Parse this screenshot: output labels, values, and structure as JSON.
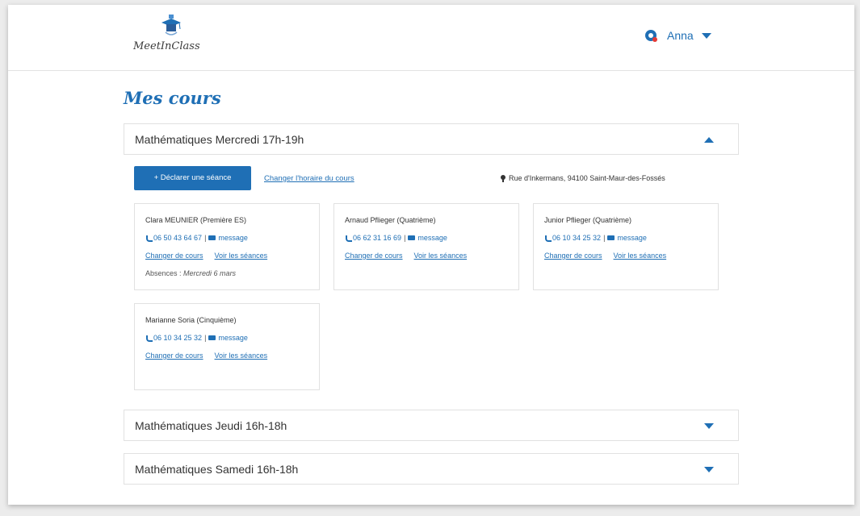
{
  "header": {
    "logo_text": "MeetInClass",
    "user_name": "Anna",
    "notification_icon": "notification-bell-icon"
  },
  "page": {
    "title": "Mes cours"
  },
  "courses": [
    {
      "title": "Mathématiques Mercredi 17h-19h",
      "expanded": true,
      "declare_button": "+ Déclarer une séance",
      "change_schedule_link": "Changer l'horaire du cours",
      "address": "Rue d'Inkermans, 94100 Saint-Maur-des-Fossés",
      "students": [
        {
          "name": "Clara MEUNIER (Première ES)",
          "phone": "06 50 43 64 67",
          "message": "message",
          "change_link": "Changer de cours",
          "sessions_link": "Voir les séances",
          "absence_label": "Absences :",
          "absence_value": "Mercredi 6 mars"
        },
        {
          "name": "Arnaud Pflieger (Quatrième)",
          "phone": "06 62 31 16 69",
          "message": "message",
          "change_link": "Changer de cours",
          "sessions_link": "Voir les séances"
        },
        {
          "name": "Junior Pflieger (Quatrième)",
          "phone": "06 10 34 25 32",
          "message": "message",
          "change_link": "Changer de cours",
          "sessions_link": "Voir les séances"
        },
        {
          "name": "Marianne Soria (Cinquième)",
          "phone": "06 10 34 25 32",
          "message": "message",
          "change_link": "Changer de cours",
          "sessions_link": "Voir les séances"
        }
      ]
    },
    {
      "title": "Mathématiques Jeudi 16h-18h",
      "expanded": false
    },
    {
      "title": "Mathématiques Samedi 16h-18h",
      "expanded": false
    }
  ],
  "colors": {
    "accent": "#1f6fb5",
    "notification_badge": "#e53935"
  }
}
